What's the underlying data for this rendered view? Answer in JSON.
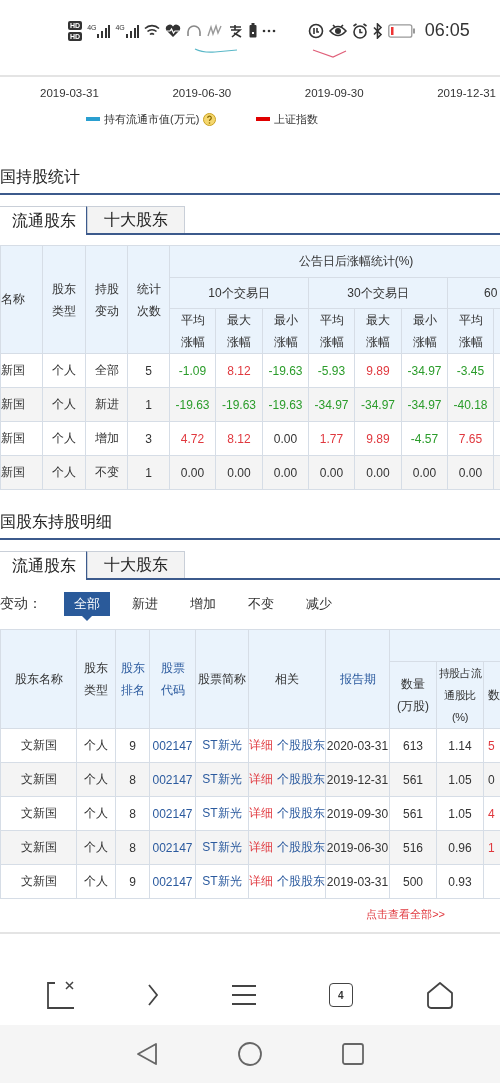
{
  "status_bar": {
    "sim_labels": [
      "HD",
      "HD"
    ],
    "network_labels": [
      "4G",
      "4G"
    ],
    "time": "06:05"
  },
  "chart": {
    "x_labels": [
      "2019-03-31",
      "2019-06-30",
      "2019-09-30",
      "2019-12-31"
    ],
    "legend": [
      {
        "label": "持有流通市值(万元)",
        "color": "#2a9fd0",
        "help": true
      },
      {
        "label": "上证指数",
        "color": "#e00000",
        "help": false
      }
    ]
  },
  "holdings_stats": {
    "title": "国持股统计",
    "tabs": [
      {
        "label": "流通股东",
        "selected": true
      },
      {
        "label": "十大股东",
        "selected": false
      }
    ],
    "table": {
      "columns": [
        "名称",
        "股东类型",
        "持股变动",
        "统计次数"
      ],
      "group_title": "公告日后涨幅统计(%)",
      "periods": [
        "10个交易日",
        "30个交易日",
        "60"
      ],
      "stat_columns": [
        "平均涨幅",
        "最大涨幅",
        "最小涨幅",
        "平均涨幅",
        "最大涨幅",
        "最小涨幅",
        "平均涨幅"
      ],
      "rows": [
        {
          "name": "新国",
          "type": "个人",
          "change": "全部",
          "count": "5",
          "stats": [
            {
              "value": "-1.09",
              "color": "#2a9c2a"
            },
            {
              "value": "8.12",
              "color": "#e0383e"
            },
            {
              "value": "-19.63",
              "color": "#2a9c2a"
            },
            {
              "value": "-5.93",
              "color": "#2a9c2a"
            },
            {
              "value": "9.89",
              "color": "#e0383e"
            },
            {
              "value": "-34.97",
              "color": "#2a9c2a"
            },
            {
              "value": "-3.45",
              "color": "#2a9c2a"
            }
          ]
        },
        {
          "name": "新国",
          "type": "个人",
          "change": "新进",
          "count": "1",
          "stats": [
            {
              "value": "-19.63",
              "color": "#2a9c2a"
            },
            {
              "value": "-19.63",
              "color": "#2a9c2a"
            },
            {
              "value": "-19.63",
              "color": "#2a9c2a"
            },
            {
              "value": "-34.97",
              "color": "#2a9c2a"
            },
            {
              "value": "-34.97",
              "color": "#2a9c2a"
            },
            {
              "value": "-34.97",
              "color": "#2a9c2a"
            },
            {
              "value": "-40.18",
              "color": "#2a9c2a"
            }
          ]
        },
        {
          "name": "新国",
          "type": "个人",
          "change": "增加",
          "count": "3",
          "stats": [
            {
              "value": "4.72",
              "color": "#e0383e"
            },
            {
              "value": "8.12",
              "color": "#e0383e"
            },
            {
              "value": "0.00",
              "color": "#333333"
            },
            {
              "value": "1.77",
              "color": "#e0383e"
            },
            {
              "value": "9.89",
              "color": "#e0383e"
            },
            {
              "value": "-4.57",
              "color": "#2a9c2a"
            },
            {
              "value": "7.65",
              "color": "#e0383e"
            }
          ]
        },
        {
          "name": "新国",
          "type": "个人",
          "change": "不变",
          "count": "1",
          "stats": [
            {
              "value": "0.00",
              "color": "#333333"
            },
            {
              "value": "0.00",
              "color": "#333333"
            },
            {
              "value": "0.00",
              "color": "#333333"
            },
            {
              "value": "0.00",
              "color": "#333333"
            },
            {
              "value": "0.00",
              "color": "#333333"
            },
            {
              "value": "0.00",
              "color": "#333333"
            },
            {
              "value": "0.00",
              "color": "#333333"
            }
          ]
        }
      ]
    }
  },
  "holdings_detail": {
    "title": "国股东持股明细",
    "tabs": [
      {
        "label": "流通股东",
        "selected": true
      },
      {
        "label": "十大股东",
        "selected": false
      }
    ],
    "filter": {
      "label": "变动：",
      "options": [
        {
          "label": "全部",
          "selected": true
        },
        {
          "label": "新进",
          "selected": false
        },
        {
          "label": "增加",
          "selected": false
        },
        {
          "label": "不变",
          "selected": false
        },
        {
          "label": "减少",
          "selected": false
        }
      ]
    },
    "table": {
      "columns": [
        {
          "label": "股东名称",
          "sortable": false
        },
        {
          "label": "股东类型",
          "sortable": false
        },
        {
          "label": "股东排名",
          "sortable": true
        },
        {
          "label": "股票代码",
          "sortable": true
        },
        {
          "label": "股票简称",
          "sortable": false
        },
        {
          "label": "相关",
          "sortable": false
        },
        {
          "label": "报告期",
          "sortable": true
        },
        {
          "label": "数量(万股)",
          "sortable": false
        },
        {
          "label": "持股占流通股比(%)",
          "sortable": false
        },
        {
          "label": "数",
          "sortable": false
        }
      ],
      "rows": [
        {
          "name": "文新国",
          "type": "个人",
          "rank": "9",
          "code": "002147",
          "short_name": "ST新光",
          "links": [
            "详细",
            "个股股东"
          ],
          "period": "2020-03-31",
          "quantity": "613",
          "ratio": "1.14",
          "column_10": {
            "value": "5",
            "color": "#e0383e"
          }
        },
        {
          "name": "文新国",
          "type": "个人",
          "rank": "8",
          "code": "002147",
          "short_name": "ST新光",
          "links": [
            "详细",
            "个股股东"
          ],
          "period": "2019-12-31",
          "quantity": "561",
          "ratio": "1.05",
          "column_10": {
            "value": "0",
            "color": "#333333"
          }
        },
        {
          "name": "文新国",
          "type": "个人",
          "rank": "8",
          "code": "002147",
          "short_name": "ST新光",
          "links": [
            "详细",
            "个股股东"
          ],
          "period": "2019-09-30",
          "quantity": "561",
          "ratio": "1.05",
          "column_10": {
            "value": "4",
            "color": "#e0383e"
          }
        },
        {
          "name": "文新国",
          "type": "个人",
          "rank": "8",
          "code": "002147",
          "short_name": "ST新光",
          "links": [
            "详细",
            "个股股东"
          ],
          "period": "2019-06-30",
          "quantity": "516",
          "ratio": "0.96",
          "column_10": {
            "value": "1",
            "color": "#e0383e"
          }
        },
        {
          "name": "文新国",
          "type": "个人",
          "rank": "9",
          "code": "002147",
          "short_name": "ST新光",
          "links": [
            "详细",
            "个股股东"
          ],
          "period": "2019-03-31",
          "quantity": "500",
          "ratio": "0.93"
        }
      ]
    },
    "more_link": "点击查看全部>>"
  },
  "browser_toolbar": {
    "tab_count": "4"
  }
}
